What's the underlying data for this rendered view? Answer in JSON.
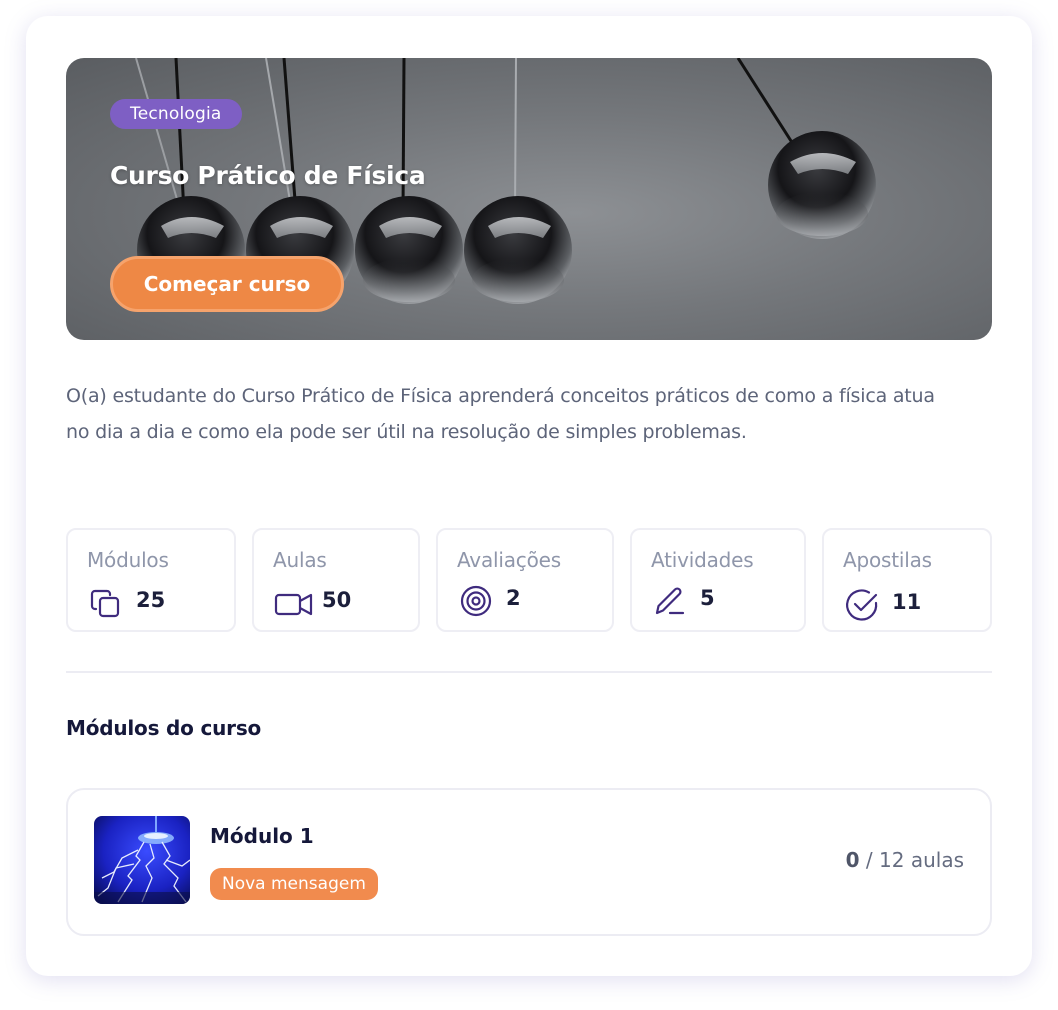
{
  "course": {
    "category": "Tecnologia",
    "title": "Curso Prático de Física",
    "start_label": "Começar curso",
    "description": "O(a) estudante do Curso Prático de Física aprenderá conceitos práticos de como a física atua no dia a dia e como ela pode ser útil na resolução de simples problemas."
  },
  "stats": [
    {
      "label": "Módulos",
      "value": "25",
      "icon": "copy-icon"
    },
    {
      "label": "Aulas",
      "value": "50",
      "icon": "video-icon"
    },
    {
      "label": "Avaliações",
      "value": "2",
      "icon": "target-icon"
    },
    {
      "label": "Atividades",
      "value": "5",
      "icon": "pencil-icon"
    },
    {
      "label": "Apostilas",
      "value": "11",
      "icon": "check-circle-icon"
    }
  ],
  "modules_section": {
    "title": "Módulos do curso",
    "items": [
      {
        "title": "Módulo 1",
        "badge": "Nova mensagem",
        "completed": "0",
        "total_text": "/ 12 aulas",
        "thumbnail": "plasma-lightning-image"
      }
    ]
  },
  "colors": {
    "accent_purple": "#7e5fc4",
    "accent_orange": "#ee8845",
    "icon_purple": "#3f2b7e",
    "text_dark": "#15183a",
    "text_muted": "#8f96aa"
  }
}
